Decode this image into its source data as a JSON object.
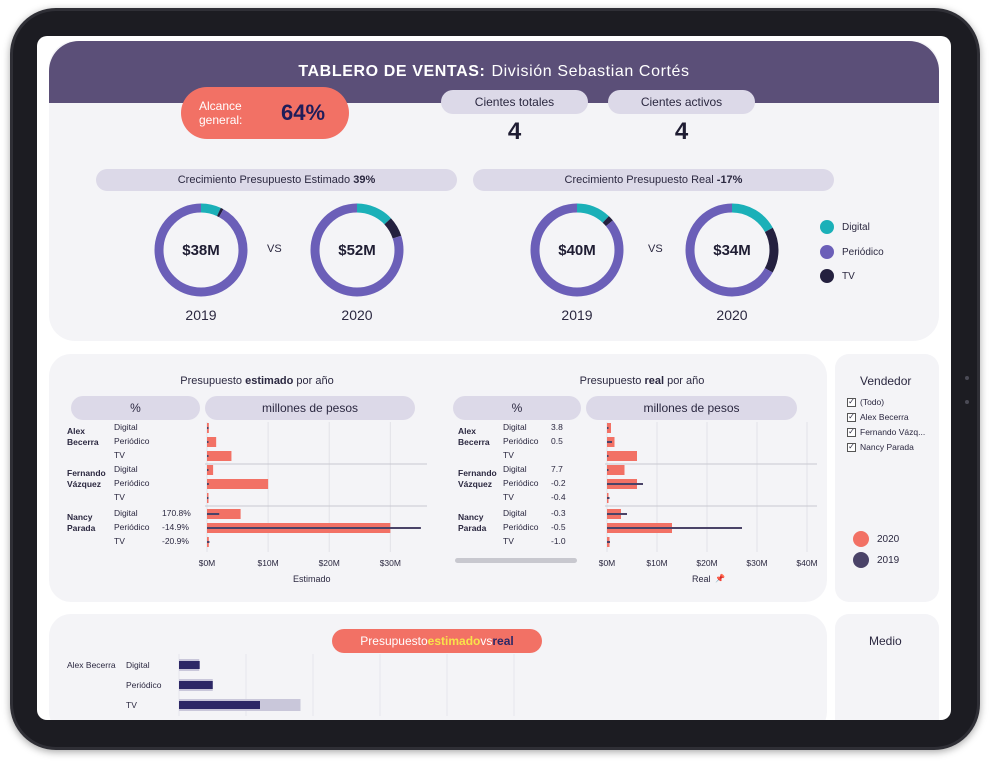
{
  "header": {
    "title_bold": "TABLERO DE VENTAS:",
    "title_rest": "División Sebastian Cortés"
  },
  "alcance": {
    "label": "Alcance general:",
    "value": "64%"
  },
  "kpis": [
    {
      "label": "Cientes totales",
      "value": "4"
    },
    {
      "label": "Cientes activos",
      "value": "4"
    }
  ],
  "growth_estimado": {
    "label": "Crecimiento Presupuesto Estimado",
    "value": "39%"
  },
  "growth_real": {
    "label": "Crecimiento Presupuesto  Real",
    "value": "-17%"
  },
  "vs_label": "VS",
  "colors": {
    "digital": "#1bb0b8",
    "periodico": "#6b5fb8",
    "tv": "#24203f",
    "y2020": "#f27165",
    "y2019": "#4a4368"
  },
  "donuts": [
    {
      "value": "$38M",
      "year": "2019",
      "shares": {
        "digital": 0.07,
        "tv": 0.01,
        "periodico": 0.92
      }
    },
    {
      "value": "$52M",
      "year": "2020",
      "shares": {
        "digital": 0.13,
        "tv": 0.07,
        "periodico": 0.8
      }
    },
    {
      "value": "$40M",
      "year": "2019",
      "shares": {
        "digital": 0.12,
        "tv": 0.02,
        "periodico": 0.86
      }
    },
    {
      "value": "$34M",
      "year": "2020",
      "shares": {
        "digital": 0.17,
        "tv": 0.16,
        "periodico": 0.67
      }
    }
  ],
  "media_legend": [
    "Digital",
    "Periódico",
    "TV"
  ],
  "chart_estimado": {
    "title_pre": "Presupuesto ",
    "title_bold": "estimado",
    "title_post": " por año",
    "col_pct": "%",
    "col_mill": "millones de pesos",
    "axis_ticks": [
      "$0M",
      "$10M",
      "$20M",
      "$30M"
    ],
    "axis_title": "Estimado"
  },
  "chart_real": {
    "title_pre": "Presupuesto ",
    "title_bold": "real",
    "title_post": " por año",
    "col_pct": "%",
    "col_mill": "millones de pesos",
    "axis_ticks": [
      "$0M",
      "$10M",
      "$20M",
      "$30M",
      "$40M"
    ],
    "axis_title": "Real"
  },
  "chart_data": [
    {
      "type": "bar",
      "title": "Presupuesto estimado por año",
      "xlabel": "Estimado",
      "xlim": [
        0,
        36
      ],
      "categories": [
        "Alex Becerra - Digital",
        "Alex Becerra - Periódico",
        "Alex Becerra - TV",
        "Fernando Vázquez - Digital",
        "Fernando Vázquez - Periódico",
        "Fernando Vázquez - TV",
        "Nancy Parada - Digital",
        "Nancy Parada - Periódico",
        "Nancy Parada - TV"
      ],
      "series": [
        {
          "name": "2020",
          "values": [
            0.3,
            1.5,
            4.0,
            1.0,
            10.0,
            0.2,
            5.5,
            30.0,
            0.3
          ]
        },
        {
          "name": "2019",
          "values": [
            0.1,
            0.2,
            0.2,
            0.2,
            0.3,
            0.1,
            2.0,
            35.0,
            0.4
          ]
        }
      ],
      "pct_labels": [
        "",
        "",
        "",
        "",
        "",
        "",
        "170.8%",
        "-14.9%",
        "-20.9%"
      ]
    },
    {
      "type": "bar",
      "title": "Presupuesto real por año",
      "xlabel": "Real",
      "xlim": [
        0,
        42
      ],
      "categories": [
        "Alex Becerra - Digital",
        "Alex Becerra - Periódico",
        "Alex Becerra - TV",
        "Fernando Vázquez - Digital",
        "Fernando Vázquez - Periódico",
        "Fernando Vázquez - TV",
        "Nancy Parada - Digital",
        "Nancy Parada - Periódico",
        "Nancy Parada - TV"
      ],
      "series": [
        {
          "name": "2020",
          "values": [
            0.8,
            1.5,
            6.0,
            3.5,
            6.0,
            0.3,
            2.8,
            13.0,
            0.5
          ]
        },
        {
          "name": "2019",
          "values": [
            0.2,
            1.0,
            0.2,
            0.3,
            7.2,
            0.5,
            4.0,
            27.0,
            0.6
          ]
        }
      ],
      "pct_labels": [
        "3.8",
        "0.5",
        "",
        "7.7",
        "-0.2",
        "-0.4",
        "-0.3",
        "-0.5",
        "-1.0"
      ]
    },
    {
      "type": "bar",
      "title": "Presupuesto estimado vs real",
      "categories": [
        "Alex Becerra - Digital",
        "Alex Becerra - Periódico",
        "Alex Becerra - TV"
      ],
      "series": [
        {
          "name": "estimado",
          "values": [
            0.2,
            2.5,
            6.0
          ]
        },
        {
          "name": "real",
          "values": [
            1.5,
            2.5,
            9.0
          ]
        }
      ]
    }
  ],
  "table": {
    "groups": [
      {
        "name1": "Alex",
        "name2": "Becerra"
      },
      {
        "name1": "Fernando",
        "name2": "Vázquez"
      },
      {
        "name1": "Nancy",
        "name2": "Parada"
      }
    ],
    "media": [
      "Digital",
      "Periódico",
      "TV"
    ]
  },
  "vendedor": {
    "title": "Vendedor",
    "options": [
      "(Todo)",
      "Alex Becerra",
      "Fernando Vázq...",
      "Nancy Parada"
    ]
  },
  "year_legend": [
    "2020",
    "2019"
  ],
  "bottom": {
    "title_pre": "Presupuesto ",
    "title_est": "estimado",
    "title_vs": " vs ",
    "title_real": "real",
    "row_name": "Alex Becerra",
    "media": [
      "Digital",
      "Periódico",
      "TV"
    ],
    "side_title": "Medio"
  }
}
